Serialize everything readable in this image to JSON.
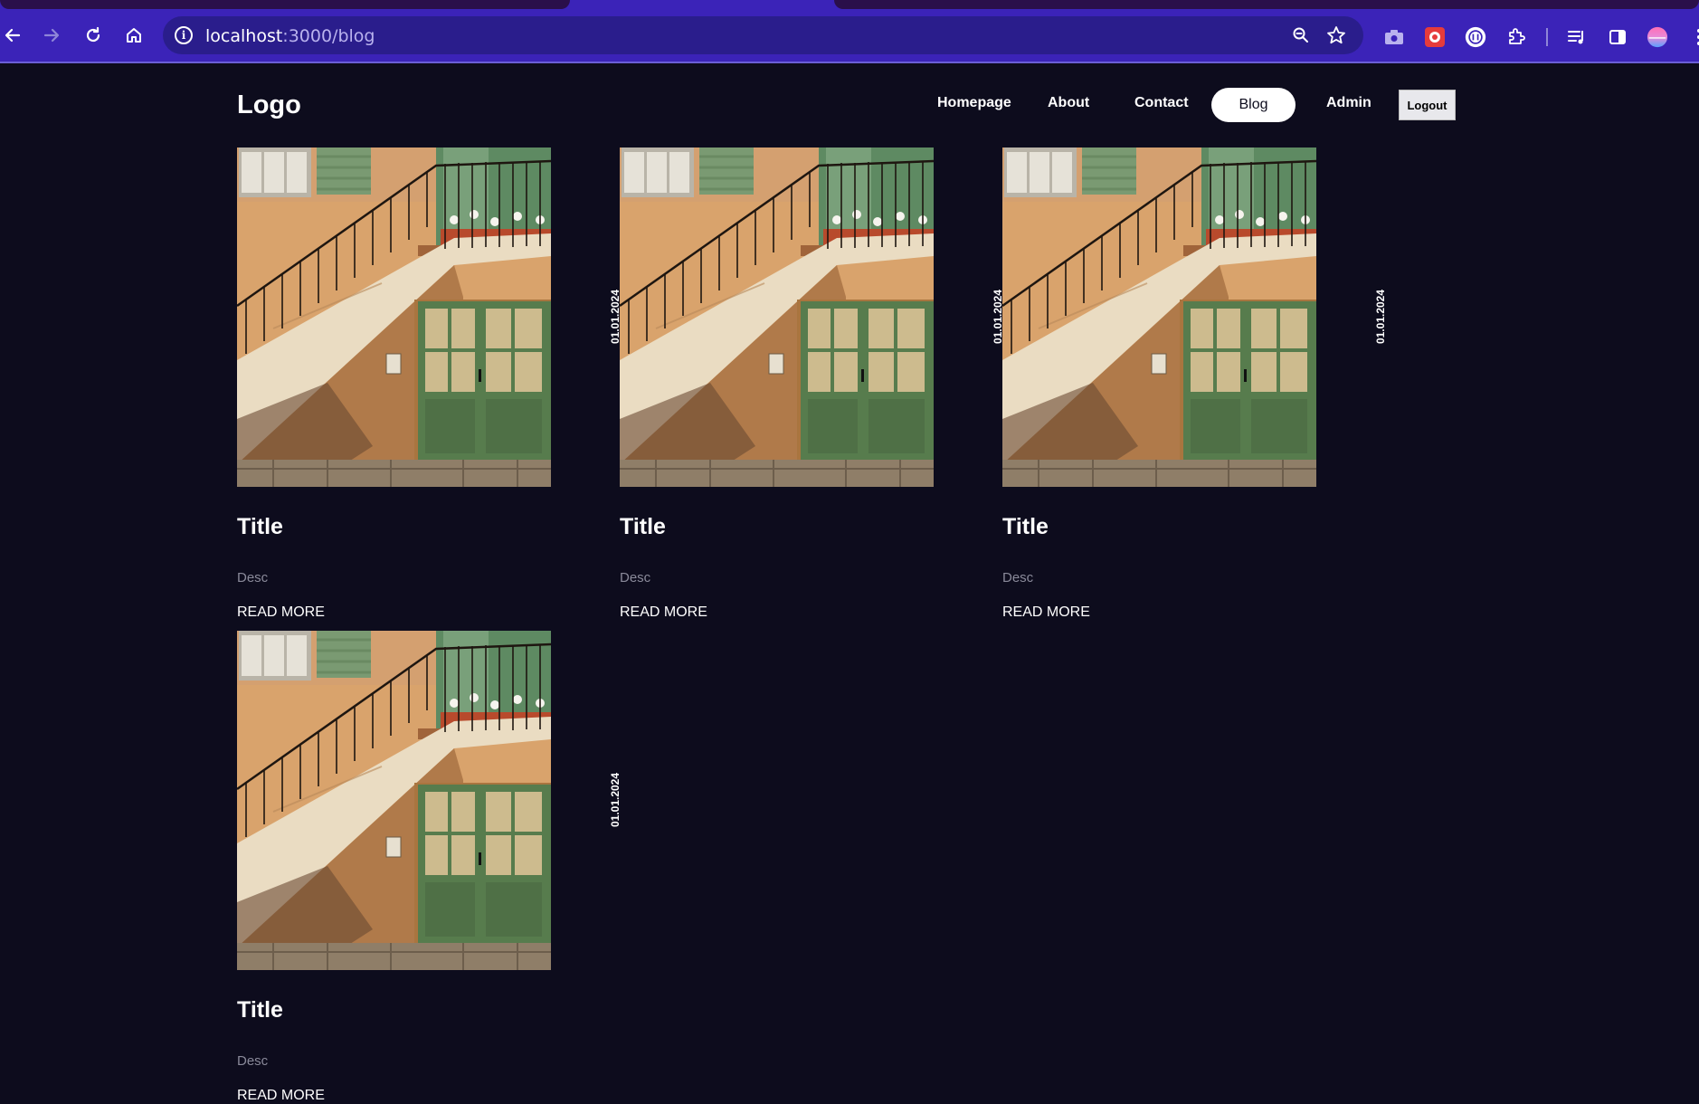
{
  "browser": {
    "url_host": "localhost",
    "url_path": ":3000/blog"
  },
  "site": {
    "logo": "Logo",
    "nav": {
      "homepage": "Homepage",
      "about": "About",
      "contact": "Contact",
      "blog": "Blog",
      "admin": "Admin",
      "logout": "Logout"
    }
  },
  "posts": [
    {
      "title": "Title",
      "desc": "Desc",
      "read_more": "READ MORE",
      "date": "01.01.2024"
    },
    {
      "title": "Title",
      "desc": "Desc",
      "read_more": "READ MORE",
      "date": "01.01.2024"
    },
    {
      "title": "Title",
      "desc": "Desc",
      "read_more": "READ MORE",
      "date": "01.01.2024"
    },
    {
      "title": "Title",
      "desc": "Desc",
      "read_more": "READ MORE",
      "date": "01.01.2024"
    }
  ],
  "colors": {
    "page_bg": "#0d0c1d",
    "browser_accent": "#3b23b8"
  }
}
